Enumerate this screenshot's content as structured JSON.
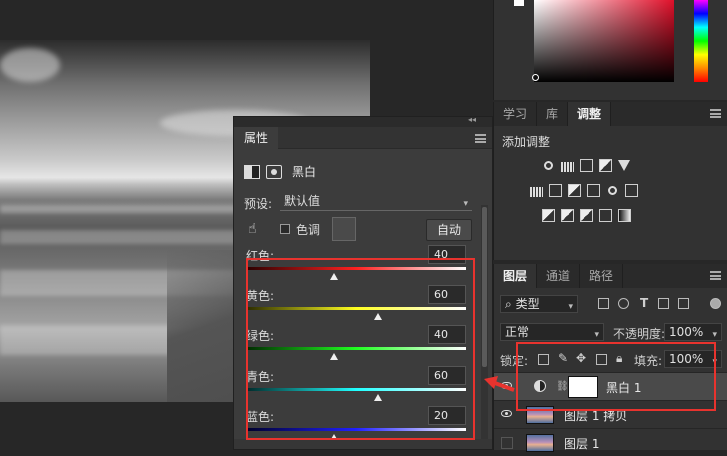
{
  "properties_panel": {
    "tab": "属性",
    "title": "黑白",
    "preset_label": "预设:",
    "preset_value": "默认值",
    "tint_label": "色调",
    "auto_button": "自动",
    "sliders": [
      {
        "label": "红色:",
        "value": "40",
        "gradient": [
          "#2a0000",
          "#ff2020",
          "#ffffff"
        ],
        "position": 0.4
      },
      {
        "label": "黄色:",
        "value": "60",
        "gradient": [
          "#2a2a00",
          "#ffff20",
          "#ffffff"
        ],
        "position": 0.6
      },
      {
        "label": "绿色:",
        "value": "40",
        "gradient": [
          "#002a00",
          "#20ff20",
          "#ffffff"
        ],
        "position": 0.4
      },
      {
        "label": "青色:",
        "value": "60",
        "gradient": [
          "#002a2a",
          "#20ffff",
          "#ffffff"
        ],
        "position": 0.6
      },
      {
        "label": "蓝色:",
        "value": "20",
        "gradient": [
          "#00002a",
          "#2020ff",
          "#ffffff"
        ],
        "position": 0.4
      }
    ]
  },
  "adjustments_panel": {
    "tabs": [
      "学习",
      "库",
      "调整"
    ],
    "active_tab": "调整",
    "title": "添加调整"
  },
  "layers_panel": {
    "tabs": [
      "图层",
      "通道",
      "路径"
    ],
    "active_tab": "图层",
    "filter_type": "类型",
    "blend_mode": "正常",
    "opacity_label": "不透明度:",
    "opacity_value": "100%",
    "lock_label": "锁定:",
    "fill_label": "填充:",
    "fill_value": "100%",
    "layers": [
      {
        "name": "黑白 1",
        "selected": true
      },
      {
        "name": "图层 1 拷贝",
        "selected": false
      },
      {
        "name": "图层 1",
        "selected": false
      }
    ]
  },
  "colors": {
    "accent_red": "#e8332e",
    "panel_bg": "#3c3c3c"
  }
}
